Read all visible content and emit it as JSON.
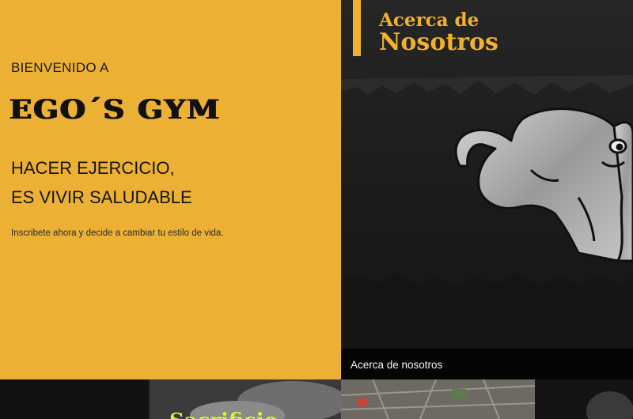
{
  "hero": {
    "welcome": "BIENVENIDO A",
    "brand": "EGO´S GYM",
    "tagline_line1": "HACER EJERCICIO,",
    "tagline_line2": "ES VIVIR SALUDABLE",
    "description": "Inscribete ahora y decide a cambiar tu estilo de vida."
  },
  "about": {
    "heading_line1": "Acerca de",
    "heading_line2": "Nosotros",
    "caption": "Acerca de nosotros"
  },
  "tiles": {
    "promo_text": "Sacrificio"
  },
  "colors": {
    "accent_yellow": "#ecb134",
    "heading_gold": "#f2b12c",
    "promo_lime": "#d6f53a"
  },
  "icons": {
    "mascot": "flexing-muscle-mascot-icon"
  }
}
